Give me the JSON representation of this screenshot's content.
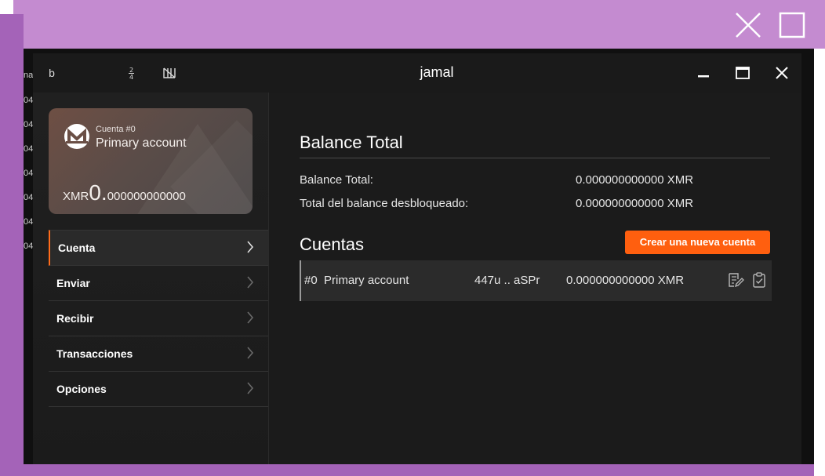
{
  "outer_window": {
    "close_icon": "close-icon",
    "maximize_icon": "maximize-icon"
  },
  "background_window": {
    "fragments": [
      "na",
      "04/",
      "04/",
      "04/",
      "04/",
      "04/",
      "04/",
      "04/"
    ]
  },
  "titlebar": {
    "title": "jamal",
    "left_icons": [
      "b",
      "2/4",
      "N"
    ],
    "controls": [
      "minimize-icon",
      "maximize-icon",
      "close-icon"
    ]
  },
  "account_card": {
    "account_index": "Cuenta #0",
    "account_name": "Primary account",
    "currency": "XMR",
    "balance_int": "0.",
    "balance_dec": "000000000000"
  },
  "sidebar": {
    "items": [
      {
        "label": "Cuenta",
        "active": true
      },
      {
        "label": "Enviar",
        "active": false
      },
      {
        "label": "Recibir",
        "active": false
      },
      {
        "label": "Transacciones",
        "active": false
      },
      {
        "label": "Opciones",
        "active": false
      }
    ]
  },
  "balance": {
    "heading": "Balance Total",
    "total_label": "Balance Total:",
    "total_value": "0.000000000000 XMR",
    "unlocked_label": "Total del balance desbloqueado:",
    "unlocked_value": "0.000000000000 XMR"
  },
  "accounts": {
    "heading": "Cuentas",
    "new_button": "Crear una nueva cuenta",
    "rows": [
      {
        "index": "#0",
        "name": "Primary account",
        "address": "447u .. aSPr",
        "balance": "0.000000000000 XMR"
      }
    ]
  },
  "colors": {
    "accent": "#ff5f0f",
    "frame_purple": "#c48bd0",
    "frame_purple_dark": "#a463b8",
    "background": "#1c1c1c"
  }
}
